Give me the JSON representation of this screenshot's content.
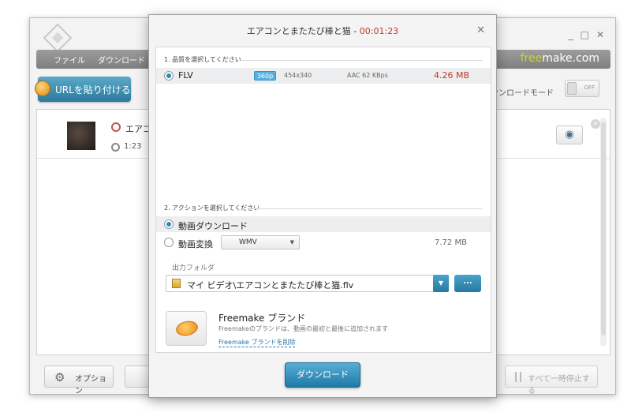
{
  "main_window": {
    "menu": [
      "ファイル",
      "ダウンロード"
    ],
    "brand": {
      "part1": "free",
      "part2": "make.com"
    },
    "url_button": "URLを貼り付ける",
    "download_mode_label": "でダウンロードモード",
    "toggle_text": "OFF",
    "row": {
      "title": "エアコン",
      "duration": "1:23"
    },
    "options_button": "オプション",
    "pause_all_button": "すべて一時停止する",
    "window_controls": [
      "_",
      "□",
      "✕"
    ]
  },
  "dialog": {
    "title": "エアコンとまたたび棒と猫",
    "title_sep": " - ",
    "duration": "00:01:23",
    "close": "✕",
    "section1_label": "1. 品質を選択してください",
    "quality": {
      "format": "FLV",
      "badge": "360p",
      "resolution": "454x340",
      "audio": "AAC 62  KBps",
      "size": "4.26 MB"
    },
    "section2_label": "2. アクションを選択してください",
    "action_download": "動画ダウンロード",
    "action_convert": "動画変換",
    "convert_format": "WMV",
    "convert_size": "7.72 MB",
    "output_label": "出力フォルダ",
    "output_path": "マイ ビデオ\\エアコンとまたたび棒と猫.flv",
    "browse_label": "...",
    "brand_title": "Freemake ブランド",
    "brand_desc": "Freemakeのブランドは、動画の最初と最後に追加されます",
    "brand_link": "Freemake ブランドを削除",
    "download_button": "ダウンロード"
  }
}
